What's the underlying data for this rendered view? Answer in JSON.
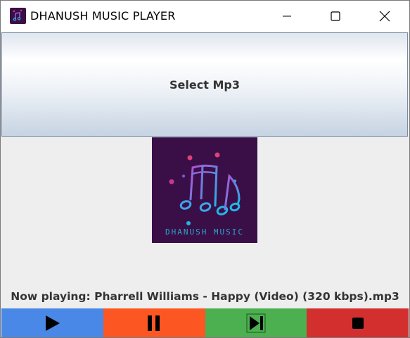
{
  "window": {
    "title": "DHANUSH MUSIC PLAYER",
    "app_icon": "music-note-icon",
    "controls": [
      "minimize-icon",
      "maximize-icon",
      "close-icon"
    ]
  },
  "select_button": {
    "label": "Select Mp3"
  },
  "album_art": {
    "caption": "DHANUSH MUSIC",
    "icon": "music-notes-icon"
  },
  "now_playing": {
    "text": "Now playing: Pharrell Williams - Happy (Video) (320 kbps).mp3"
  },
  "playback_controls": [
    {
      "name": "play",
      "icon": "play-icon",
      "color": "#4a88e8"
    },
    {
      "name": "pause",
      "icon": "pause-icon",
      "color": "#fc5722"
    },
    {
      "name": "next",
      "icon": "skip-next-icon",
      "color": "#4caf50"
    },
    {
      "name": "stop",
      "icon": "stop-icon",
      "color": "#d32f2f"
    }
  ]
}
